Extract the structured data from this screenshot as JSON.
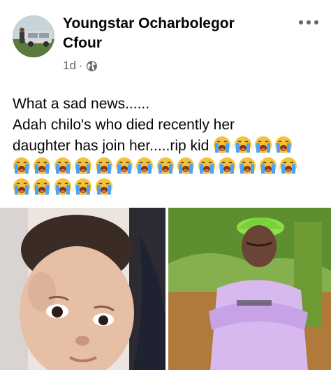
{
  "post": {
    "author": "Youngstar Ocharbolegor Cfour",
    "time": "1d",
    "separator": "·",
    "privacy_icon": "globe-icon",
    "more_icon": "more-options-icon",
    "text_lines": [
      "What a sad news......",
      "Adah chilo's who died recently her",
      "daughter has join her.....rip kid"
    ],
    "emoji_name": "loudly-crying-face-icon",
    "emoji_counts": {
      "line3": 4,
      "line4": 14,
      "line5": 5
    }
  },
  "colors": {
    "text": "#050505",
    "meta": "#65676b",
    "emoji": "#f5c33b",
    "tear": "#4fa3f7"
  }
}
